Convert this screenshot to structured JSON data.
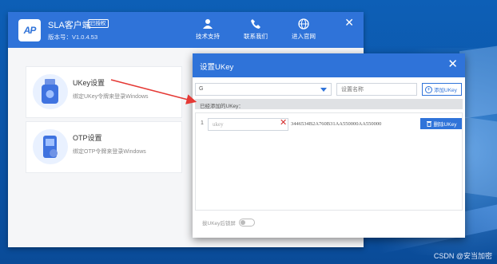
{
  "app": {
    "logo_text": "AP",
    "name": "SLA客户端",
    "badge": "已授权",
    "version": "版本号：V1.0.4.53"
  },
  "nav": [
    {
      "label": "技术支持",
      "icon": "user-support-icon"
    },
    {
      "label": "联系我们",
      "icon": "phone-icon"
    },
    {
      "label": "进入官网",
      "icon": "globe-icon"
    }
  ],
  "cards": [
    {
      "title": "UKey设置",
      "desc": "绑定UKey令牌来登录Windows",
      "icon": "usb-key-icon"
    },
    {
      "title": "OTP设置",
      "desc": "绑定OTP令牌来登录Windows",
      "icon": "otp-token-icon"
    }
  ],
  "dialog": {
    "title": "设置UKey",
    "group_value": "G",
    "name_placeholder": "设置名称",
    "add_button": "添加UKey",
    "added_header": "已经添加的UKey：",
    "rows": [
      {
        "index": "1",
        "ukey_value": "ukey",
        "serial": "3446534B2A760B31AA550000AA550000",
        "delete_label": "删除UKey"
      }
    ],
    "footer_label": "拔UKey后锁屏"
  },
  "watermark": "CSDN @安当加密",
  "colors": {
    "primary": "#2f73d9",
    "danger": "#d42a2a",
    "arrow": "#e53935"
  }
}
